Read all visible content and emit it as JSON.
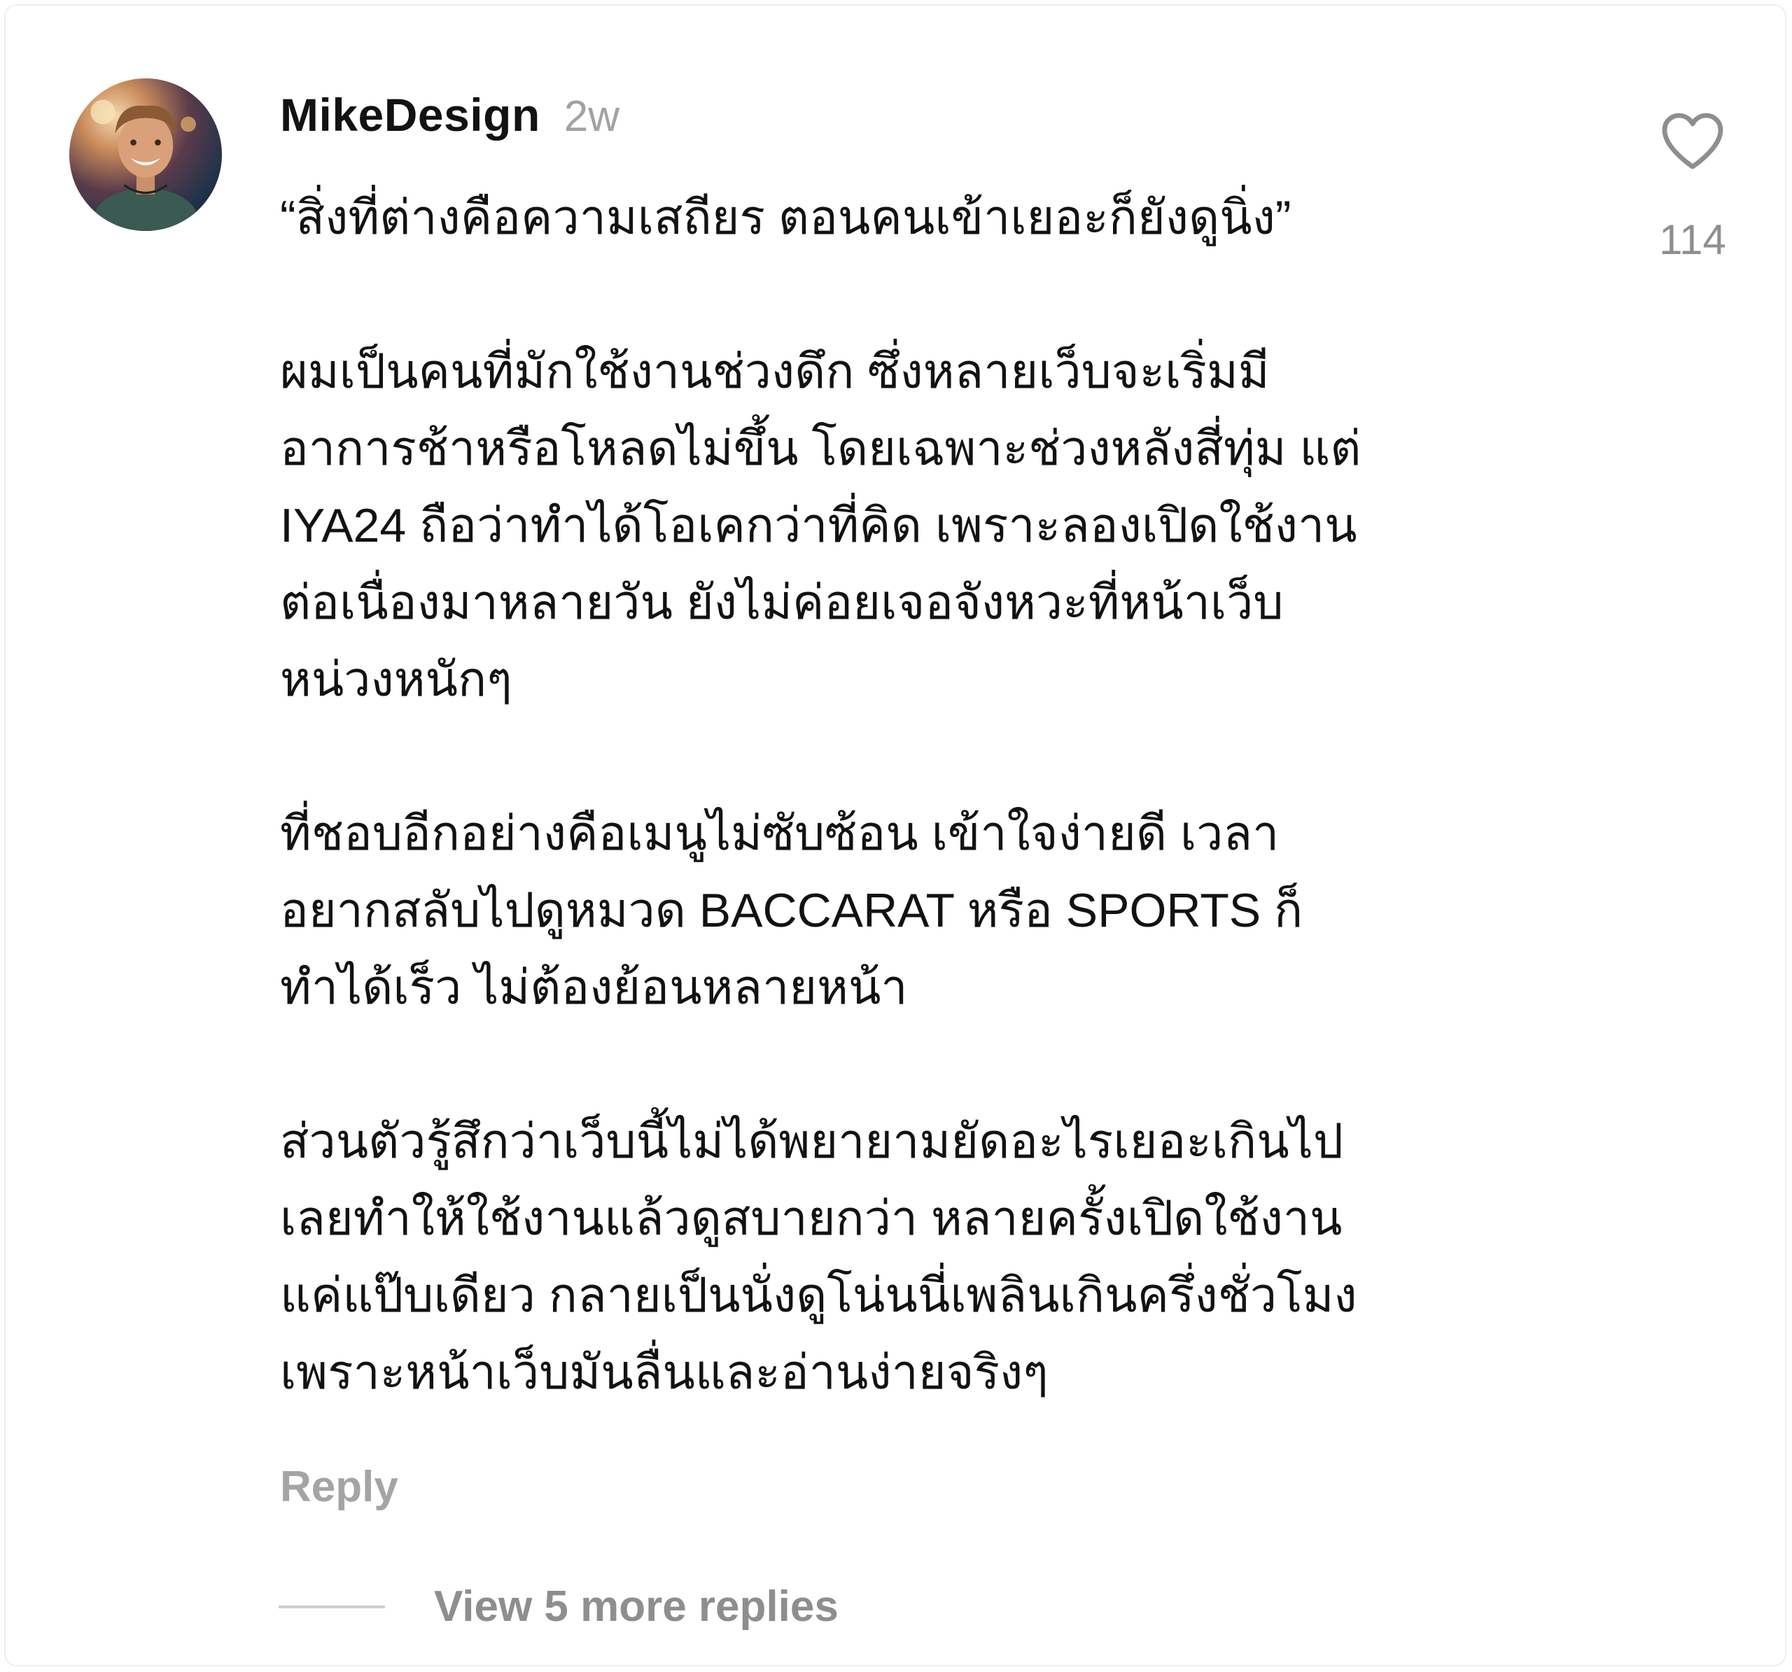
{
  "comment": {
    "username": "MikeDesign",
    "time_ago": "2w",
    "avatar_icon": "user-avatar-photo",
    "paragraphs": [
      "“สิ่งที่ต่างคือความเสถียร ตอนคนเข้าเยอะก็ยังดูนิ่ง”",
      "ผมเป็นคนที่มักใช้งานช่วงดึก ซึ่งหลายเว็บจะเริ่มมี\nอาการช้าหรือโหลดไม่ขึ้น โดยเฉพาะช่วงหลังสี่ทุ่ม แต่\nIYA24 ถือว่าทำได้โอเคกว่าที่คิด เพราะลองเปิดใช้งาน\nต่อเนื่องมาหลายวัน ยังไม่ค่อยเจอจังหวะที่หน้าเว็บ\nหน่วงหนักๆ",
      "ที่ชอบอีกอย่างคือเมนูไม่ซับซ้อน เข้าใจง่ายดี เวลา\nอยากสลับไปดูหมวด BACCARAT หรือ SPORTS ก็\nทำได้เร็ว ไม่ต้องย้อนหลายหน้า",
      "ส่วนตัวรู้สึกว่าเว็บนี้ไม่ได้พยายามยัดอะไรเยอะเกินไป\nเลยทำให้ใช้งานแล้วดูสบายกว่า หลายครั้งเปิดใช้งาน\nแค่แป๊บเดียว กลายเป็นนั่งดูโน่นนี่เพลินเกินครึ่งชั่วโมง\nเพราะหน้าเว็บมันลื่นและอ่านง่ายจริงๆ"
    ],
    "reply_label": "Reply",
    "view_more_label": "View 5 more replies",
    "like_icon": "heart-outline-icon",
    "like_count": "114"
  },
  "colors": {
    "text_primary": "#121212",
    "text_secondary": "#a2a2a2",
    "icon_gray": "#8e8e8e",
    "background": "#ffffff"
  }
}
